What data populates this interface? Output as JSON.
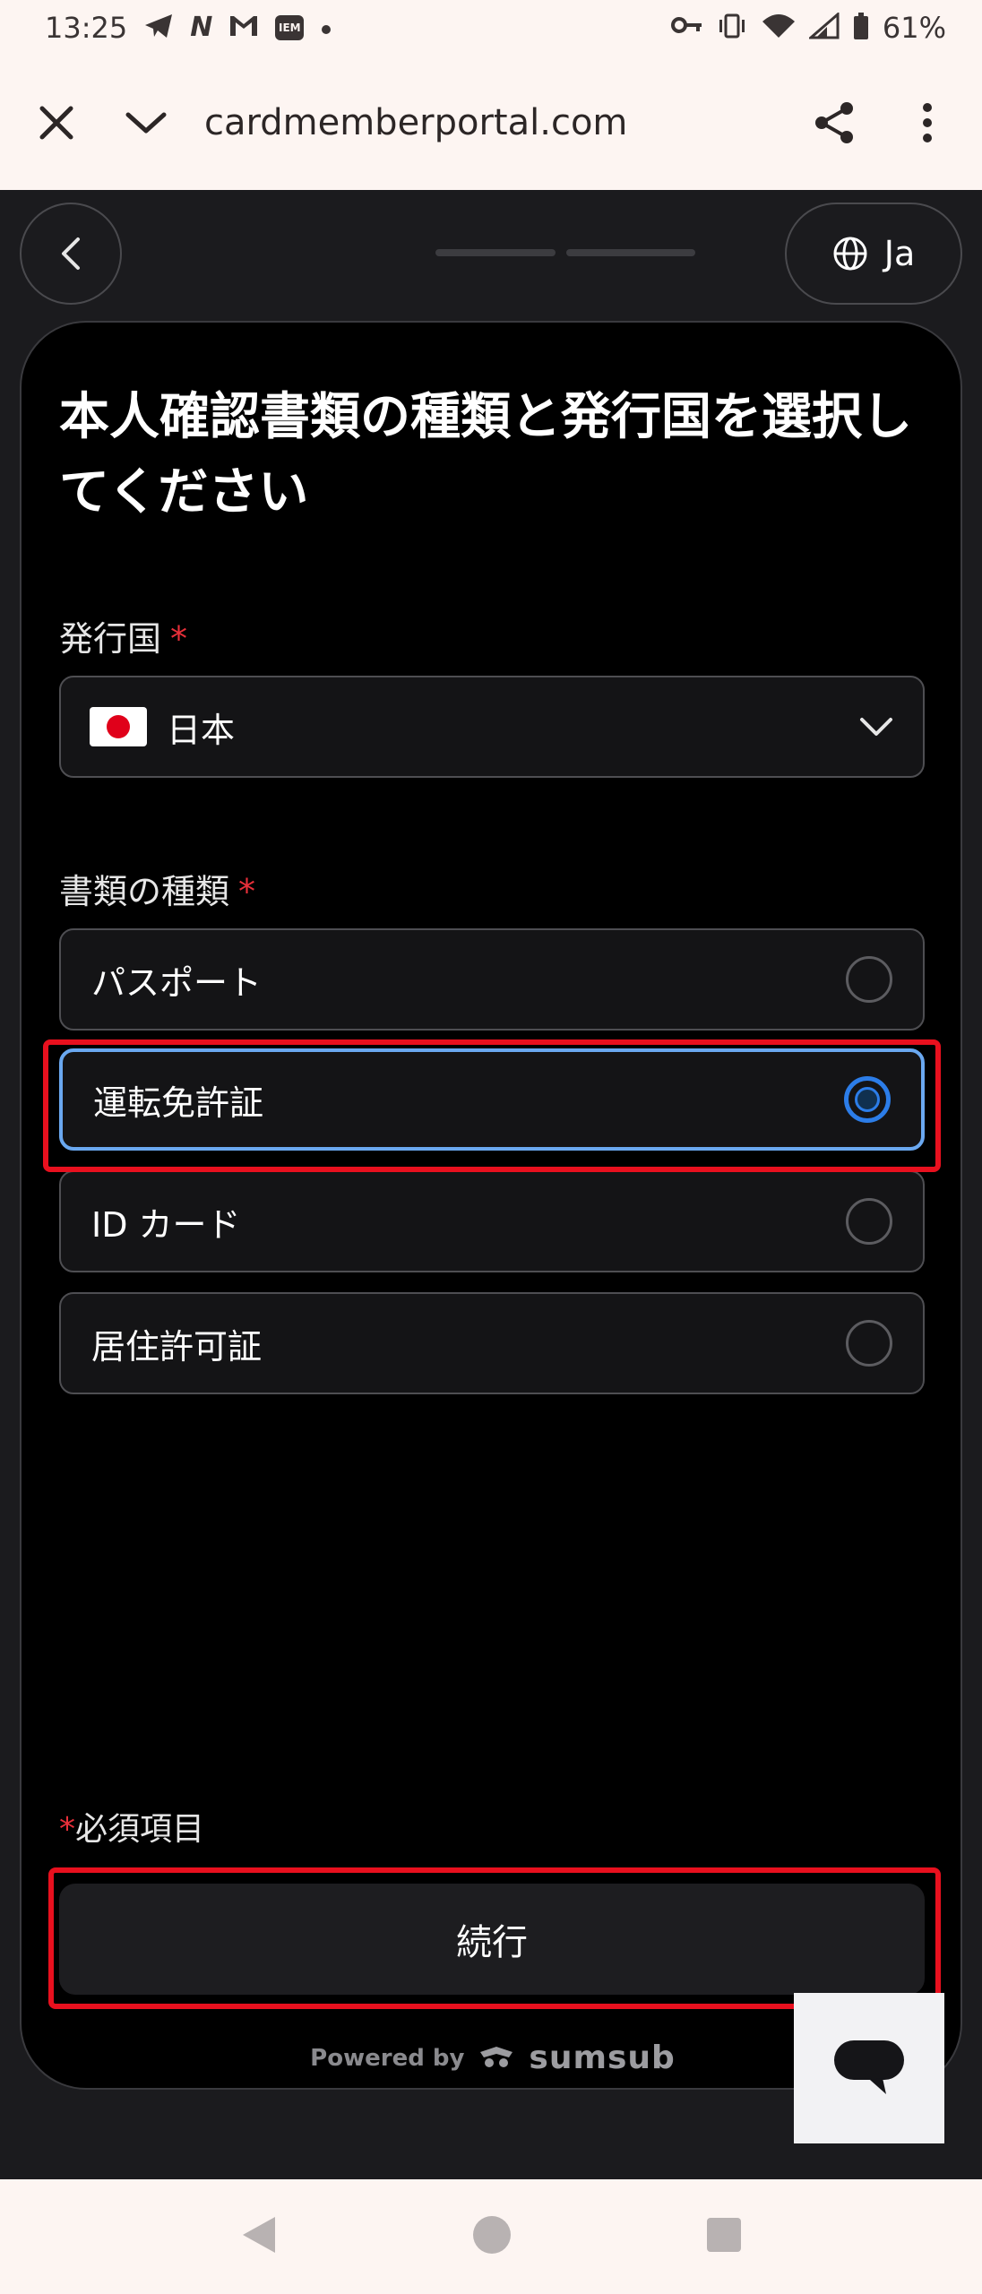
{
  "status_bar": {
    "time": "13:25",
    "notification_badge": "IEM",
    "battery": "61%"
  },
  "browser": {
    "url": "cardmemberportal.com"
  },
  "header": {
    "language": "Ja"
  },
  "form": {
    "title": "本人確認書類の種類と発行国を選択してください",
    "country_label": "発行国",
    "required_mark": "*",
    "country_value": "日本",
    "doc_type_label": "書類の種類",
    "doc_types": [
      {
        "label": "パスポート",
        "selected": false
      },
      {
        "label": "運転免許証",
        "selected": true
      },
      {
        "label": "ID カード",
        "selected": false
      },
      {
        "label": "居住許可証",
        "selected": false
      }
    ],
    "required_note": "必須項目",
    "continue_label": "続行",
    "powered_by": "Powered by",
    "brand": "sumsub"
  },
  "colors": {
    "accent": "#2c7de8",
    "highlight": "#e8101e",
    "required": "#e8303a"
  }
}
